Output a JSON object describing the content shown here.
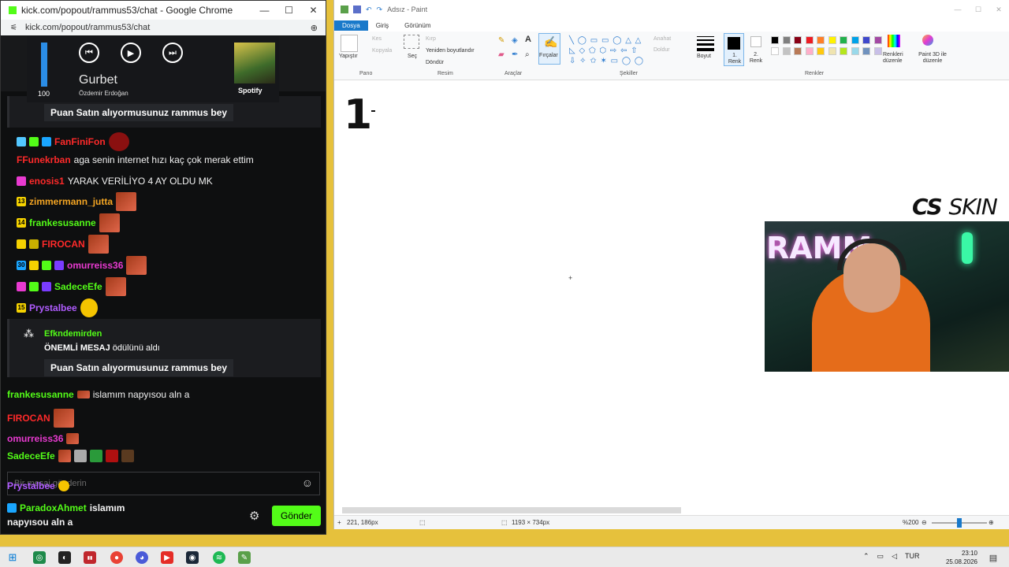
{
  "chat_window": {
    "title": "kick.com/popout/rammus53/chat - Google Chrome",
    "url": "kick.com/popout/rammus53/chat",
    "media": {
      "volume_label": "100",
      "volume_level": 1.0,
      "track": "Gurbet",
      "artist": "Özdemir Erdoğan",
      "source": "Spotify"
    },
    "reward_pill_top": "Puan Satın alıyormusunuz rammus bey",
    "messages": [
      {
        "user": "FanFiniFon",
        "text": "",
        "user_color": "#ff2a2a"
      },
      {
        "user": "FFunekrban",
        "text": "aga senin internet hızı kaç çok merak ettim",
        "user_color": "#ff2a2a"
      },
      {
        "user": "enosis1",
        "text": "YARAK VERİLİYO 4 AY OLDU MK",
        "user_color": "#ff2a2a"
      },
      {
        "user": "zimmermann_jutta",
        "text": "",
        "user_color": "#f5a623",
        "badge": "13"
      },
      {
        "user": "frankesusanne",
        "text": "",
        "user_color": "#53fc18",
        "badge": "14"
      },
      {
        "user": "FIROCAN",
        "text": "",
        "user_color": "#ff2a2a"
      },
      {
        "user": "omurreiss36",
        "text": "",
        "user_color": "#e83ad0",
        "badge": "30"
      },
      {
        "user": "SadeceEfe",
        "text": "",
        "user_color": "#53fc18"
      },
      {
        "user": "Prystalbee",
        "text": "",
        "user_color": "#b05cff",
        "badge": "15"
      }
    ],
    "reward": {
      "user": "Efkndemirden",
      "action_bold": "ÖNEMLİ MESAJ",
      "action_rest": "ödülünü aldı",
      "pill": "Puan Satın alıyormusunuz rammus bey"
    },
    "overlay_lines": [
      {
        "user": "frankesusanne",
        "text": "islamım napyısou aln a"
      },
      {
        "user": "FIROCAN",
        "text": ""
      },
      {
        "user": "omurreiss36",
        "text": ""
      },
      {
        "user": "SadeceEfe",
        "text": ""
      },
      {
        "user": "Prystalbee",
        "text": ""
      },
      {
        "user": "ParadoxAhmet",
        "text": "islamım"
      },
      {
        "user": "",
        "text": "napyısou aln a"
      }
    ],
    "input_placeholder": "Bir mesaj gönderin",
    "send_label": "Gönder"
  },
  "paint": {
    "title": "Adsız - Paint",
    "tabs": [
      "Dosya",
      "Giriş",
      "Görünüm"
    ],
    "groups": [
      "Pano",
      "Resim",
      "Araçlar",
      "Şekiller",
      "Renkler"
    ],
    "clipboard": {
      "paste": "Yapıştır",
      "cut": "Kes",
      "copy": "Kopyala"
    },
    "image": {
      "select": "Seç",
      "crop": "Kırp",
      "resize": "Yeniden boyutlandır",
      "rotate": "Döndür"
    },
    "brushes": "Fırçalar",
    "shapes": {
      "outline": "Anahat",
      "fill": "Doldur"
    },
    "size": "Boyut",
    "color1": "1. Renk",
    "color2": "2. Renk",
    "edit_colors": "Renkleri düzenle",
    "paint3d": "Paint 3D ile düzenle",
    "palette": [
      "#000000",
      "#7f7f7f",
      "#880015",
      "#ed1c24",
      "#ff7f27",
      "#fff200",
      "#22b14c",
      "#00a2e8",
      "#3f48cc",
      "#a349a4",
      "#ffffff",
      "#c3c3c3",
      "#b97a57",
      "#ffaec9",
      "#ffc90e",
      "#efe4b0",
      "#b5e61d",
      "#99d9ea",
      "#7092be",
      "#c8bfe7"
    ],
    "status": {
      "cursor_pos": "221, 186px",
      "canvas_size": "1193 × 734px",
      "zoom": "%200"
    }
  },
  "overlay": {
    "cs_skin_bold": "CS",
    "cs_skin_thin": "SKIN",
    "webcam_sign": "RAMM"
  },
  "taskbar": {
    "lang": "TUR",
    "time": "23:10",
    "date": "25.08.2026"
  }
}
